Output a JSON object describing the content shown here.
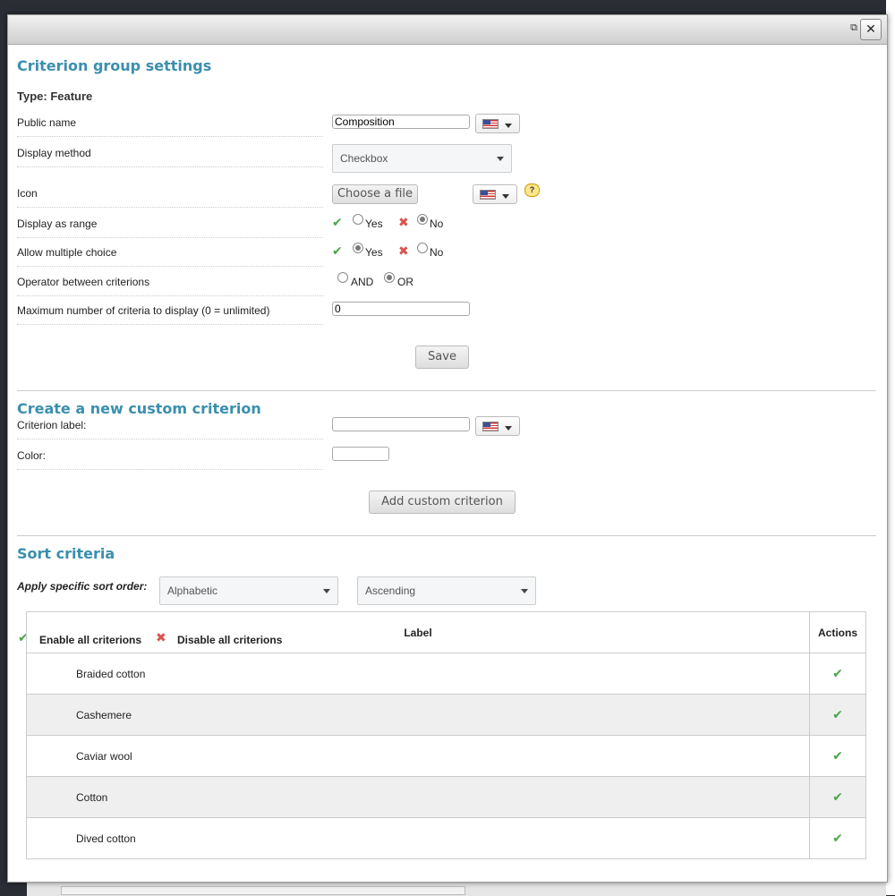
{
  "window": {
    "restore_icon": "restore-icon",
    "close_icon": "close-icon"
  },
  "group_settings": {
    "title": "Criterion group settings",
    "type_label": "Type: Feature",
    "public_name": {
      "label": "Public name",
      "value": "Composition"
    },
    "display_method": {
      "label": "Display method",
      "value": "Checkbox"
    },
    "icon": {
      "label": "Icon",
      "file_button": "Choose a file"
    },
    "display_as_range": {
      "label": "Display as range",
      "yes": "Yes",
      "no": "No",
      "selected": "No"
    },
    "allow_multiple": {
      "label": "Allow multiple choice",
      "yes": "Yes",
      "no": "No",
      "selected": "Yes"
    },
    "operator": {
      "label": "Operator between criterions",
      "and": "AND",
      "or": "OR",
      "selected": "OR"
    },
    "max_criteria": {
      "label": "Maximum number of criteria to display (0 = unlimited)",
      "value": "0"
    },
    "save": "Save"
  },
  "custom_criterion": {
    "title": "Create a new custom criterion",
    "label_field": "Criterion label:",
    "color_field": "Color:",
    "add_button": "Add custom criterion"
  },
  "sort": {
    "title": "Sort criteria",
    "apply_label": "Apply specific sort order:",
    "order_by": "Alphabetic",
    "direction": "Ascending",
    "enable_all": "Enable all criterions",
    "disable_all": "Disable all criterions"
  },
  "table": {
    "headers": {
      "label": "Label",
      "actions": "Actions"
    },
    "rows": [
      "Braided cotton",
      "Cashemere",
      "Caviar wool",
      "Cotton",
      "Dived cotton"
    ]
  },
  "colors": {
    "heading": "#3a8fae",
    "check": "#4aa64a",
    "cross": "#d9534f"
  }
}
